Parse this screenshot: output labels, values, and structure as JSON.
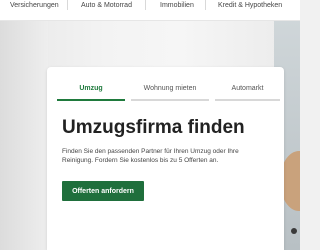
{
  "top_nav": {
    "items": [
      {
        "label": "Versicherungen"
      },
      {
        "label": "Auto & Motorrad"
      },
      {
        "label": "Immobilien"
      },
      {
        "label": "Kredit & Hypotheken"
      }
    ]
  },
  "card": {
    "tabs": [
      {
        "label": "Umzug",
        "active": true
      },
      {
        "label": "Wohnung mieten",
        "active": false
      },
      {
        "label": "Automarkt",
        "active": false
      }
    ],
    "title": "Umzugsfirma finden",
    "description": "Finden Sie den passenden Partner für Ihren Umzug oder Ihre Reinigung. Fordern Sie kostenlos bis zu 5 Offerten an.",
    "cta_label": "Offerten anfordern"
  },
  "colors": {
    "accent": "#1f7a3d",
    "button": "#1f6f3c"
  }
}
